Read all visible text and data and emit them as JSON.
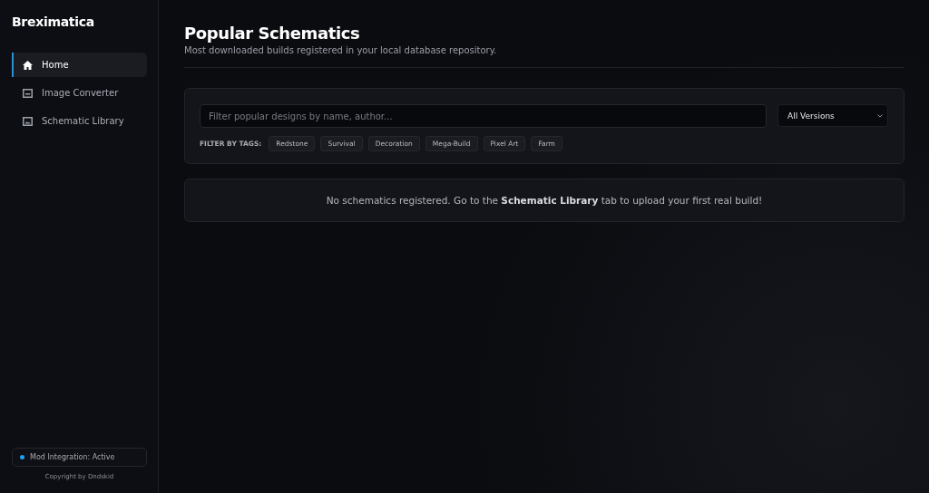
{
  "sidebar": {
    "brand": "Breximatica",
    "items": [
      {
        "label": "Home",
        "kind": "home",
        "selected": true
      },
      {
        "label": "Image Converter",
        "kind": "converter",
        "selected": false
      },
      {
        "label": "Schematic Library",
        "kind": "library",
        "selected": false
      }
    ],
    "status": {
      "label": "Mod Integration: Active",
      "on": true
    },
    "copyright": "Copyright by Dndskid"
  },
  "main": {
    "title": "Popular Schematics",
    "subtitle": "Most downloaded builds registered in your local database repository.",
    "search": {
      "placeholder": "Filter popular designs by name, author..."
    },
    "version_select": {
      "value": "All Versions"
    },
    "tags_label": "FILTER BY TAGS:",
    "tags": [
      {
        "label": "Redstone",
        "selected": false
      },
      {
        "label": "Survival",
        "selected": false
      },
      {
        "label": "Decoration",
        "selected": false
      },
      {
        "label": "Mega-Build",
        "selected": false
      },
      {
        "label": "Pixel Art",
        "selected": false
      },
      {
        "label": "Farm",
        "selected": false
      }
    ],
    "empty_message": "No schematics registered. Go to the **Schematic Library** tab to upload your first real build!"
  }
}
